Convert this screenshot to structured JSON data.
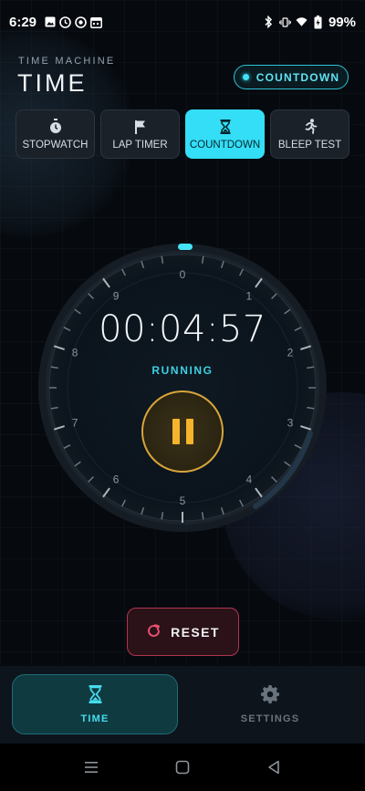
{
  "status_bar": {
    "time": "6:29",
    "battery": "99%",
    "left_icons": [
      "image-icon",
      "clock-icon",
      "sync-icon",
      "calendar-icon"
    ],
    "right_icons": [
      "bluetooth-icon",
      "vibrate-icon",
      "wifi-icon",
      "battery-icon"
    ]
  },
  "header": {
    "subtitle": "TIME MACHINE",
    "title": "TIME",
    "mode_badge": "COUNTDOWN"
  },
  "tabs": [
    {
      "label": "STOPWATCH",
      "icon": "stopwatch-icon",
      "active": false
    },
    {
      "label": "LAP TIMER",
      "icon": "flag-icon",
      "active": false
    },
    {
      "label": "COUNTDOWN",
      "icon": "hourglass-icon",
      "active": true
    },
    {
      "label": "BLEEP TEST",
      "icon": "runner-icon",
      "active": false
    }
  ],
  "timer": {
    "display": "00:04:57",
    "status": "RUNNING",
    "dial_numbers": [
      "0",
      "1",
      "2",
      "3",
      "4",
      "5",
      "6",
      "7",
      "8",
      "9"
    ],
    "progress_fraction": 0.0
  },
  "controls": {
    "pause_icon": "pause-icon",
    "reset_label": "RESET",
    "reset_icon": "reset-icon"
  },
  "bottom_nav": {
    "items": [
      {
        "label": "TIME",
        "icon": "hourglass-icon",
        "active": true
      },
      {
        "label": "SETTINGS",
        "icon": "gear-icon",
        "active": false
      }
    ]
  },
  "colors": {
    "accent": "#33def6",
    "pause_accent": "#f5b42c",
    "reset_accent": "#b0354f",
    "background": "#060a0f"
  }
}
